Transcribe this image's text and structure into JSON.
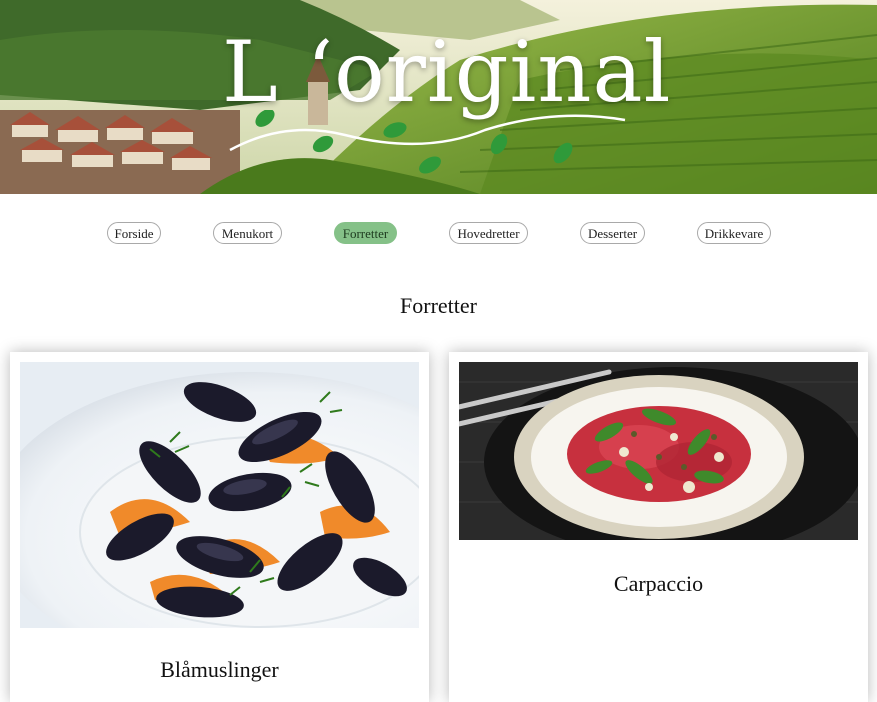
{
  "header": {
    "logo_text": "L ‘original"
  },
  "nav": {
    "items": [
      {
        "label": "Forside"
      },
      {
        "label": "Menukort"
      },
      {
        "label": "Forretter"
      },
      {
        "label": "Hovedretter"
      },
      {
        "label": "Desserter"
      },
      {
        "label": "Drikkevare"
      }
    ],
    "active": "Forretter",
    "active_color": "#85c188"
  },
  "main": {
    "title": "Forretter",
    "cards": [
      {
        "title": "Blåmuslinger",
        "image": "mussels-dish-photo"
      },
      {
        "title": "Carpaccio",
        "image": "carpaccio-dish-photo"
      }
    ]
  }
}
